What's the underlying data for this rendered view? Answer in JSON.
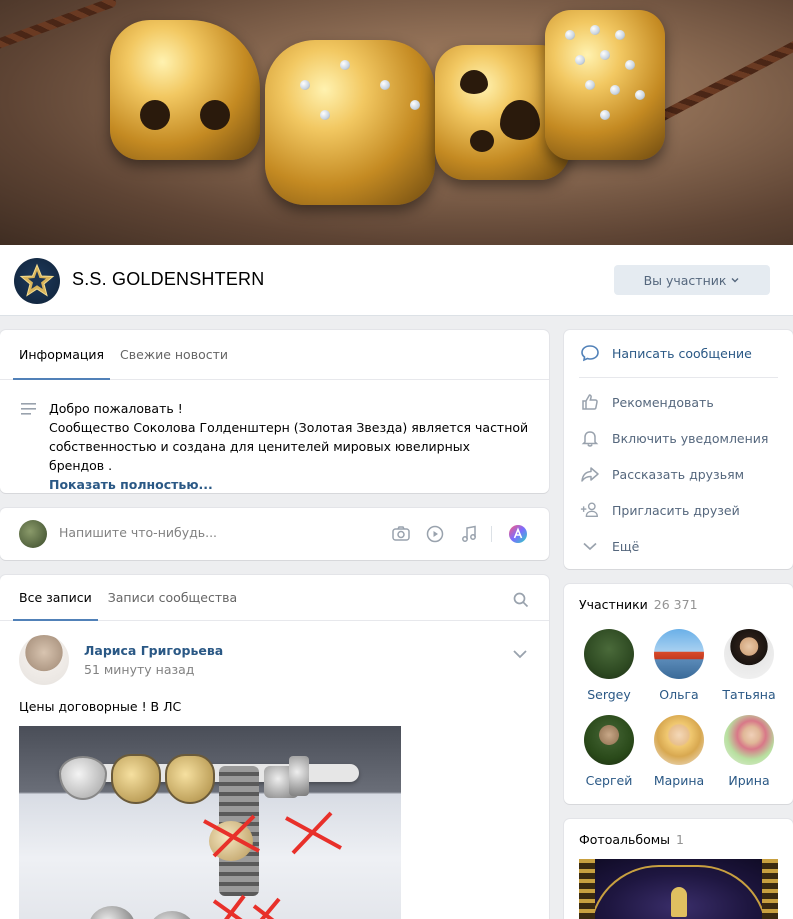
{
  "group": {
    "name": "S.S. GOLDENSHTERN",
    "member_button": "Вы участник"
  },
  "info_tabs": [
    {
      "label": "Информация",
      "active": true
    },
    {
      "label": "Свежие новости",
      "active": false
    }
  ],
  "info": {
    "greeting": "Добро пожаловать !",
    "description": "Сообщество Соколова Голденштерн (Золотая Звезда) является частной собственностью и создана для ценителей мировых ювелирных брендов .",
    "show_more": "Показать полностью..."
  },
  "composer": {
    "placeholder": "Напишите что-нибудь..."
  },
  "wall_tabs": [
    {
      "label": "Все записи",
      "active": true
    },
    {
      "label": "Записи сообщества",
      "active": false
    }
  ],
  "post": {
    "author": "Лариса Григорьева",
    "time": "51 минуту назад",
    "text": "Цены договорные ! В ЛС"
  },
  "actions": [
    {
      "label": "Написать сообщение",
      "icon": "message-icon"
    },
    {
      "label": "Рекомендовать",
      "icon": "thumbs-up-icon"
    },
    {
      "label": "Включить уведомления",
      "icon": "bell-icon"
    },
    {
      "label": "Рассказать друзьям",
      "icon": "share-icon"
    },
    {
      "label": "Пригласить друзей",
      "icon": "add-user-icon"
    },
    {
      "label": "Ещё",
      "icon": "chevron-down-icon"
    }
  ],
  "members": {
    "title": "Участники",
    "count": "26 371",
    "list": [
      {
        "name": "Sergey"
      },
      {
        "name": "Ольга"
      },
      {
        "name": "Татьяна"
      },
      {
        "name": "Сергей"
      },
      {
        "name": "Марина"
      },
      {
        "name": "Ирина"
      }
    ]
  },
  "albums": {
    "title": "Фотоальбомы",
    "count": "1"
  },
  "colors": {
    "link": "#2a5885",
    "accent": "#5181b8",
    "background": "#edeef0"
  }
}
